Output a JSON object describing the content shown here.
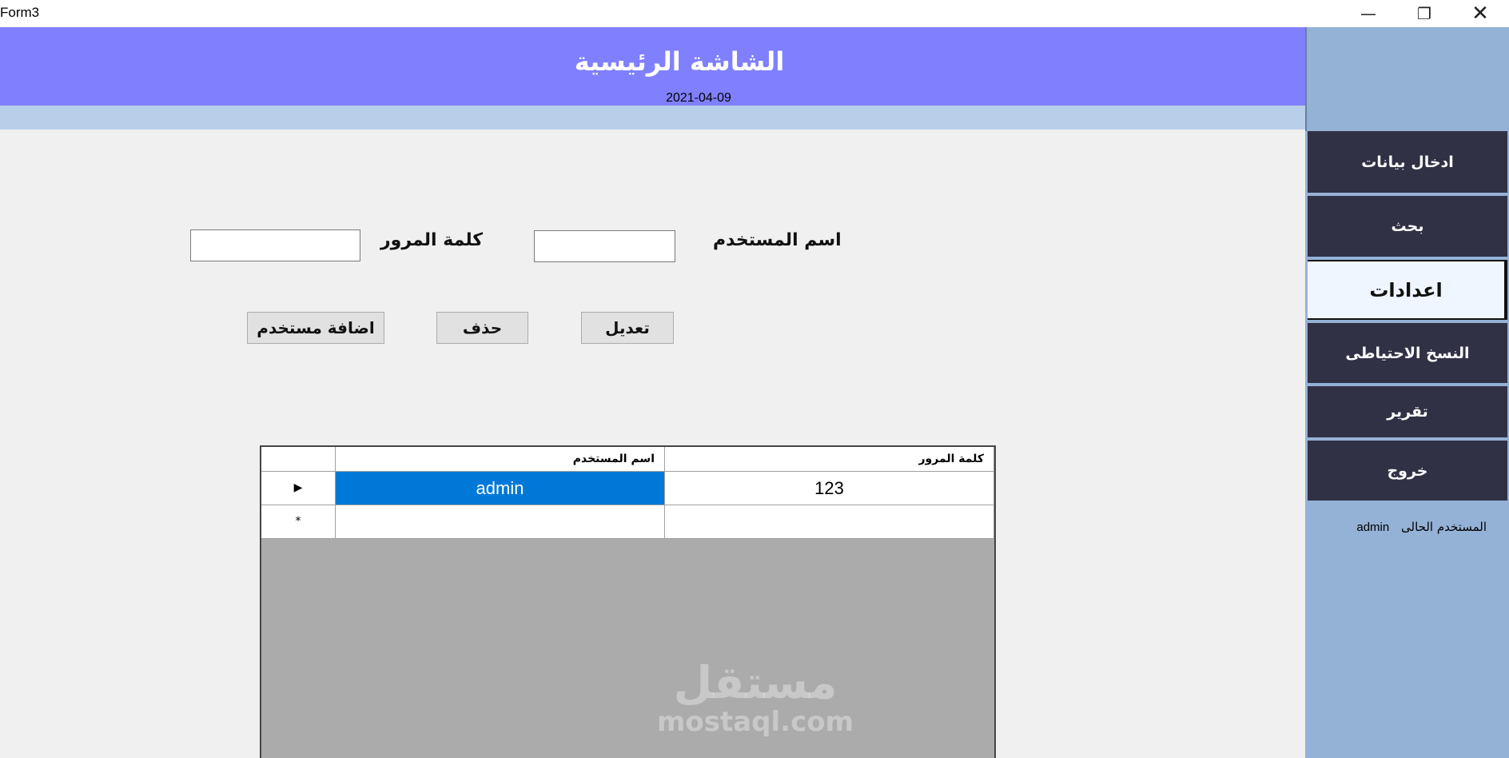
{
  "window": {
    "title": "Form3",
    "minimize_glyph": "—",
    "maximize_glyph": "❐",
    "close_glyph": "✕"
  },
  "header": {
    "title": "الشاشة الرئيسية",
    "date": "2021-04-09"
  },
  "sidebar": {
    "items": [
      {
        "label": "ادخال بيانات"
      },
      {
        "label": "بحث"
      },
      {
        "label": "اعدادات",
        "active": true
      },
      {
        "label": "النسخ الاحتياطى"
      },
      {
        "label": "تقرير"
      },
      {
        "label": "خروج"
      }
    ],
    "current_user_label": "المستخدم الحالى",
    "current_user_value": "admin"
  },
  "form": {
    "username_label": "اسم المستخدم",
    "password_label": "كلمة المرور",
    "username_value": "",
    "password_value": "",
    "edit_button": "تعديل",
    "delete_button": "حذف",
    "add_button": "اضافة مستخدم"
  },
  "grid": {
    "columns": [
      "اسم المستخدم",
      "كلمة المرور"
    ],
    "rows": [
      {
        "indicator": "▶",
        "username": "admin",
        "password": "123",
        "selected_cell": "username"
      }
    ],
    "new_row_indicator": "*"
  },
  "watermark": {
    "arabic": "مستقل",
    "latin": "mostaql.com"
  },
  "colors": {
    "header": "#8080ff",
    "subband": "#b8cfe9",
    "sidebar": "#94b2d6",
    "nav_button": "#313146",
    "nav_active": "#eff6ff",
    "selection": "#0078d7",
    "grid_background": "#ababab"
  }
}
